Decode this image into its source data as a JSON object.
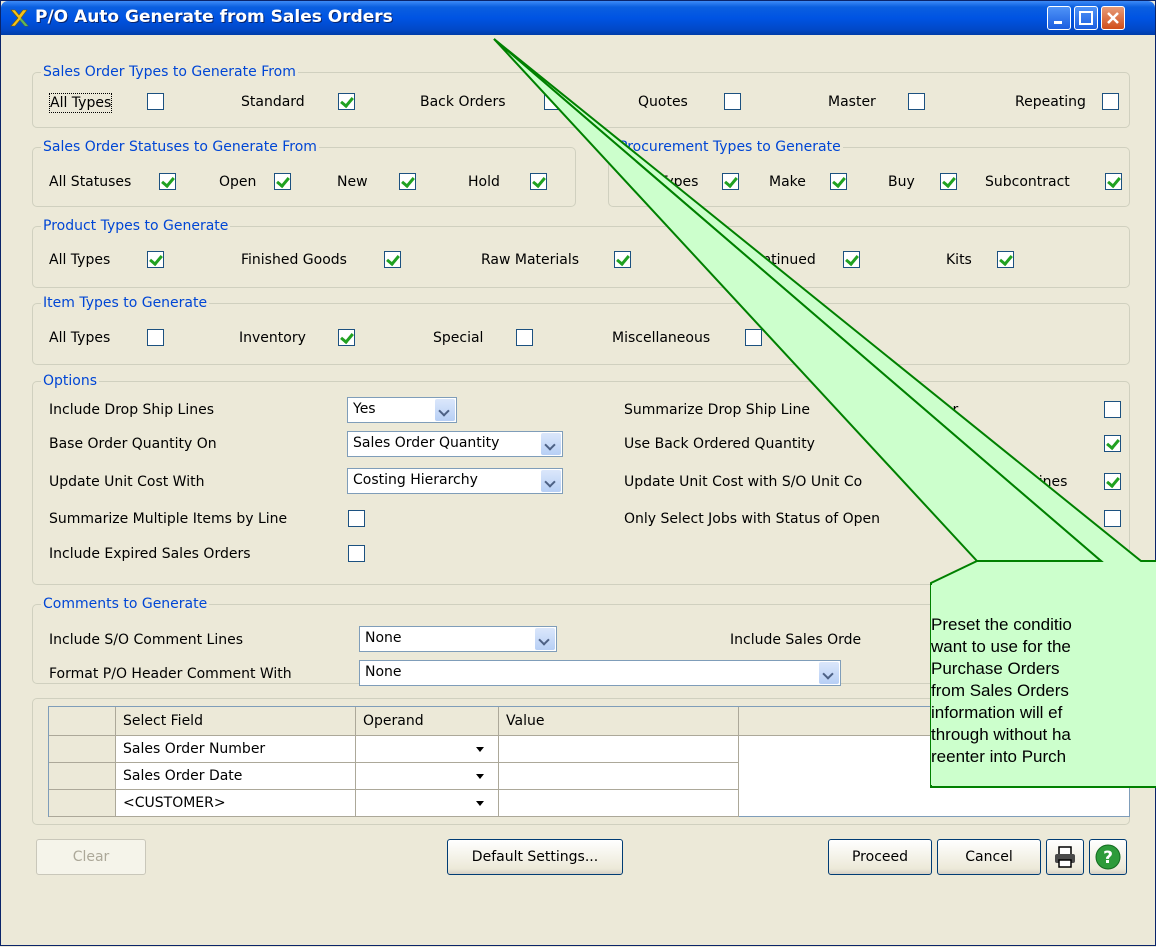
{
  "window": {
    "title": "P/O Auto Generate from Sales Orders",
    "icon": "app-x-icon",
    "accent": "#0054e3"
  },
  "so_types": {
    "label": "Sales Order Types to Generate From",
    "items": [
      {
        "label": "All Types",
        "checked": false
      },
      {
        "label": "Standard",
        "checked": true
      },
      {
        "label": "Back Orders",
        "checked": false
      },
      {
        "label": "Quotes",
        "checked": false
      },
      {
        "label": "Master",
        "checked": false
      },
      {
        "label": "Repeating",
        "checked": false
      }
    ]
  },
  "so_statuses": {
    "label": "Sales Order Statuses to Generate From",
    "items": [
      {
        "label": "All Statuses",
        "checked": true
      },
      {
        "label": "Open",
        "checked": true
      },
      {
        "label": "New",
        "checked": true
      },
      {
        "label": "Hold",
        "checked": true
      }
    ]
  },
  "procurement": {
    "label": "Procurement Types to Generate",
    "items": [
      {
        "label": "Types",
        "checked": true
      },
      {
        "label": "Make",
        "checked": true
      },
      {
        "label": "Buy",
        "checked": true
      },
      {
        "label": "Subcontract",
        "checked": true
      }
    ]
  },
  "product_types": {
    "label": "Product Types to Generate",
    "items": [
      {
        "label": "All Types",
        "checked": true
      },
      {
        "label": "Finished Goods",
        "checked": true
      },
      {
        "label": "Raw Materials",
        "checked": true
      },
      {
        "label": "continued",
        "checked": true
      },
      {
        "label": "Kits",
        "checked": true
      }
    ]
  },
  "item_types": {
    "label": "Item Types to Generate",
    "items": [
      {
        "label": "All Types",
        "checked": false
      },
      {
        "label": "Inventory",
        "checked": true
      },
      {
        "label": "Special",
        "checked": false
      },
      {
        "label": "Miscellaneous",
        "checked": false
      }
    ]
  },
  "options": {
    "label": "Options",
    "drop_ship": {
      "label": "Include Drop Ship Lines",
      "value": "Yes"
    },
    "base_qty": {
      "label": "Base Order Quantity On",
      "value": "Sales Order Quantity"
    },
    "unit_cost": {
      "label": "Update Unit Cost With",
      "value": "Costing Hierarchy"
    },
    "summarize_items": {
      "label": "Summarize Multiple Items by Line",
      "checked": false
    },
    "expired": {
      "label": "Include Expired Sales Orders",
      "checked": false
    },
    "summarize_drop": {
      "label": "Summarize Drop Ship Line",
      "label_tail": "dor",
      "checked": false
    },
    "back_ordered": {
      "label": "Use Back Ordered Quantity",
      "checked": true
    },
    "so_unit_cost": {
      "label": "Update Unit Cost with S/O Unit Co",
      "label_tail": "Ship Lines",
      "checked": true
    },
    "only_open_jobs": {
      "label": "Only Select Jobs with Status of Open",
      "checked": false
    }
  },
  "comments": {
    "label": "Comments to Generate",
    "so_comment_lines": {
      "label": "Include S/O Comment Lines",
      "value": "None"
    },
    "header_comment": {
      "label": "Format P/O Header Comment With",
      "value": "None"
    },
    "include_sales_order": {
      "label": "Include Sales Orde"
    }
  },
  "grid": {
    "columns": [
      "Select Field",
      "Operand",
      "Value"
    ],
    "rows": [
      "Sales Order Number",
      "Sales Order Date",
      "<CUSTOMER>"
    ]
  },
  "buttons": {
    "clear": "Clear",
    "default_settings": "Default Settings...",
    "proceed": "Proceed",
    "cancel": "Cancel",
    "print_icon": "printer-icon",
    "help_icon": "help-icon"
  },
  "callout": {
    "text": "Preset the conditio\nwant to use for the\nPurchase Orders\nfrom Sales Orders\ninformation will ef\nthrough without ha\nreenter into Purch",
    "fill": "#ccffcc",
    "stroke": "#008000"
  }
}
